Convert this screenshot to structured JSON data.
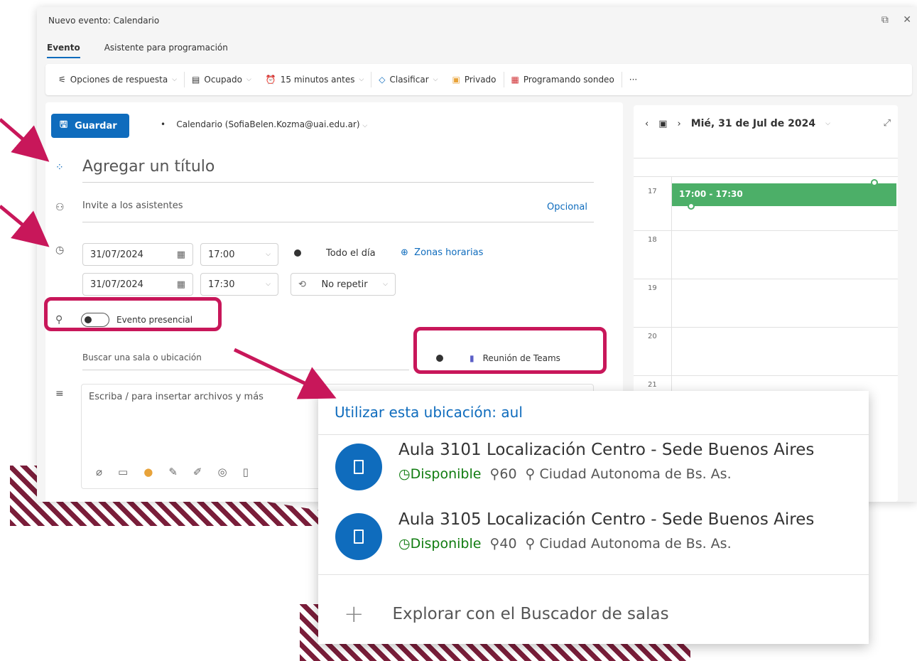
{
  "window": {
    "title": "Nuevo evento: Calendario",
    "controls": "⧉ ✕"
  },
  "tabs": [
    {
      "label": "Evento",
      "active": true
    },
    {
      "label": "Asistente para programación",
      "active": false
    }
  ],
  "toolbar": {
    "response_options": "Opciones de respuesta",
    "status": "Ocupado",
    "reminder": "15 minutos antes",
    "categorize": "Clasificar",
    "private": "Privado",
    "poll": "Programando sondeo",
    "more": "···"
  },
  "form": {
    "save_label": "Guardar",
    "calendar": "Calendario (SofiaBelen.Kozma@uai.edu.ar)",
    "title_placeholder": "Agregar un título",
    "attendees_placeholder": "Invite a los asistentes",
    "optional_label": "Opcional",
    "start_date": "31/07/2024",
    "start_time": "17:00",
    "end_date": "31/07/2024",
    "end_time": "17:30",
    "all_day_label": "Todo el día",
    "timezones_label": "Zonas horarias",
    "repeat_label": "No repetir",
    "in_person_label": "Evento presencial",
    "location_placeholder": "Buscar una sala o ubicación",
    "teams_label": "Reunión de Teams",
    "body_placeholder": "Escriba / para insertar archivos y más"
  },
  "calendar_panel": {
    "date": "Mié, 31 de Jul de 2024",
    "hours": [
      "17",
      "18",
      "19",
      "20",
      "21"
    ],
    "event_time": "17:00 - 17:30",
    "event_color": "#4caf68"
  },
  "location_popup": {
    "use_location": "Utilizar esta ubicación: aul",
    "rooms": [
      {
        "name": "Aula 3101 Localización Centro - Sede Buenos Aires",
        "status": "Disponible",
        "capacity": "60",
        "location": "Ciudad Autonoma de Bs. As."
      },
      {
        "name": "Aula 3105 Localización Centro - Sede Buenos Aires",
        "status": "Disponible",
        "capacity": "40",
        "location": "Ciudad Autonoma de Bs. As."
      }
    ],
    "explore": "Explorar con el Buscador de salas"
  },
  "colors": {
    "accent": "#0f6cbd",
    "highlight": "#c8175a",
    "stripes": "#7a1e3a",
    "available": "#107c10"
  }
}
